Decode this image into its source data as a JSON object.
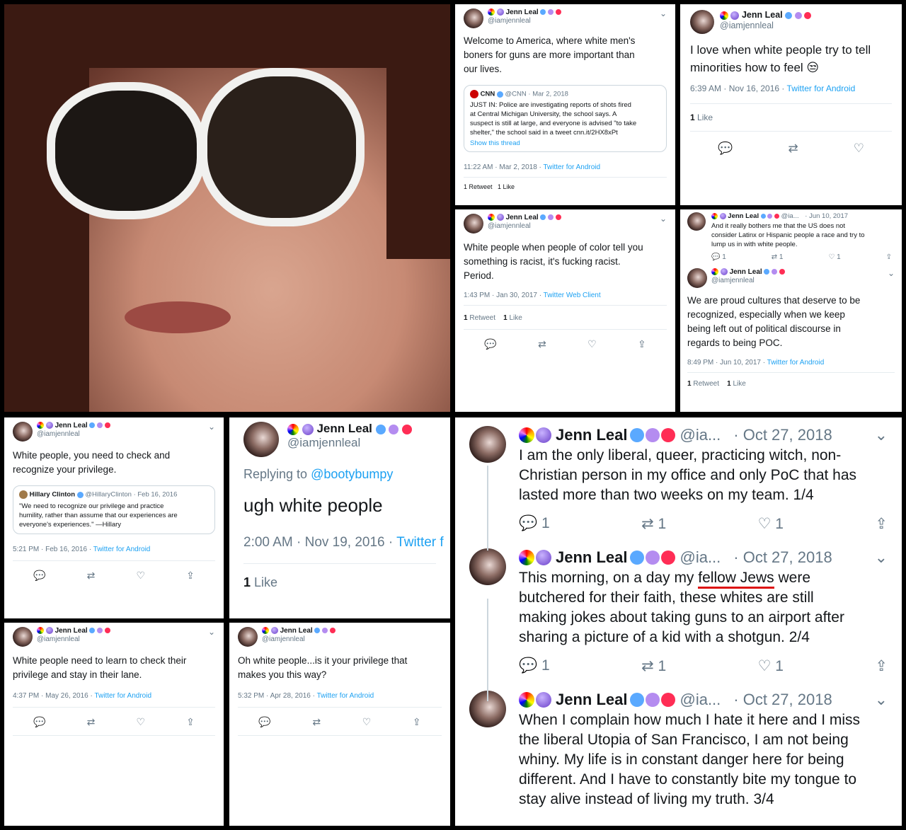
{
  "user": {
    "name": "Jenn Leal",
    "handle": "@iamjennleal",
    "handle_short": "@ia...",
    "handle_med": "@ia..."
  },
  "t1": {
    "text": "Welcome to America, where white men's\nboners for guns are more important than\nour lives.",
    "quote_source": "CNN",
    "quote_handle": "@CNN",
    "quote_date": "Mar 2, 2018",
    "quote_text": "JUST IN: Police are investigating reports of shots fired\nat Central Michigan University, the school says. A\nsuspect is still at large, and everyone is advised \"to take\nshelter,\" the school said in a tweet cnn.it/2HX8xPt",
    "quote_link": "Show this thread",
    "time": "11:22 AM · Mar 2, 2018 · ",
    "client": "Twitter for Android",
    "stats": "1 Retweet   1 Like"
  },
  "t2": {
    "text": "I love when white people try to tell\nminorities how to feel 😒",
    "time": "6:39 AM · Nov 16, 2016 · ",
    "client": "Twitter for Android",
    "likes_n": "1",
    "likes_l": " Like"
  },
  "t3": {
    "text": "White people when people of color tell you\nsomething is racist, it's fucking racist.\nPeriod.",
    "time": "1:43 PM · Jan 30, 2017 · ",
    "client": "Twitter Web Client",
    "rt_n": "1",
    "rt_l": " Retweet",
    "like_n": "1",
    "like_l": " Like"
  },
  "t4": {
    "parent_date": "· Jun 10, 2017",
    "parent_text": "And it really bothers me that the US does not\nconsider Latinx or Hispanic people a race and try to\nlump us in with white people.",
    "p_reply": "1",
    "p_rt": "1",
    "p_like": "1",
    "text": "We are proud cultures that deserve to be\nrecognized, especially when we keep\nbeing left out of political discourse in\nregards to being POC.",
    "time": "8:49 PM · Jun 10, 2017 · ",
    "client": "Twitter for Android",
    "rt_n": "1",
    "rt_l": " Retweet",
    "like_n": "1",
    "like_l": " Like"
  },
  "t5": {
    "text": "White people, you need to check and\nrecognize your privilege.",
    "quote_source": "Hillary Clinton",
    "quote_handle": "@HillaryClinton · Feb 16, 2016",
    "quote_text": "\"We need to recognize our privilege and practice\nhumility, rather than assume that our experiences are\neveryone's experiences.\" —Hillary",
    "time": "5:21 PM · Feb 16, 2016 · ",
    "client": "Twitter for Android"
  },
  "t6": {
    "replying": "Replying to ",
    "replying_to": "@bootybumpy",
    "text": "ugh white people",
    "time": "2:00 AM · Nov 19, 2016 · ",
    "client": "Twitter f",
    "like_n": "1",
    "like_l": " Like"
  },
  "t7": {
    "text": "White people need to learn to check their\nprivilege and stay in their lane.",
    "time": "4:37 PM · May 26, 2016 · ",
    "client": "Twitter for Android"
  },
  "t8": {
    "text": "Oh white people...is it your privilege that\nmakes you this way?",
    "time": "5:32 PM · Apr 28, 2016 · ",
    "client": "Twitter for Android"
  },
  "thread": {
    "date": "· Oct 27, 2018",
    "a_text": "I am the only liberal, queer, practicing witch, non-\nChristian person in my office and only PoC that has\nlasted more than two weeks on my team. 1/4",
    "b_pre": "This morning, on a day my ",
    "b_mark": "fellow Jews",
    "b_post": " were\nbutchered for their faith, these whites are still\nmaking jokes about taking guns to an airport after\nsharing a picture of a kid with a shotgun. 2/4",
    "c_text": "When I complain how much I hate it here and I miss\nthe liberal Utopia of San Francisco, I am not being\nwhiny. My life is in constant danger here for being\ndifferent. And I have to constantly bite my tongue to\nstay alive instead of living my truth. 3/4",
    "count": "1"
  },
  "icons": {
    "reply": "💬",
    "retweet": "⇄",
    "like": "♡",
    "share": "⇪",
    "chevron": "⌄"
  }
}
